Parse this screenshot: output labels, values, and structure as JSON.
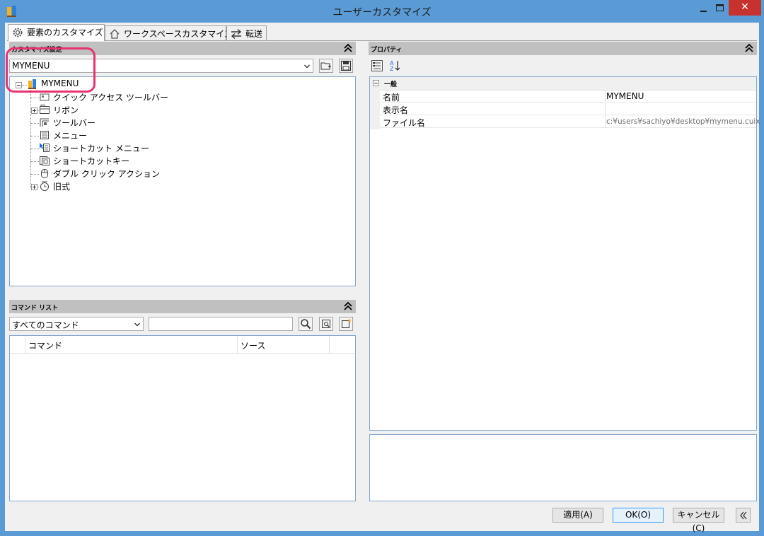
{
  "window": {
    "title": "ユーザーカスタマイズ"
  },
  "tabs": [
    {
      "label": "要素のカスタマイズ"
    },
    {
      "label": "ワークスペースカスタマイズ"
    },
    {
      "label": "転送"
    }
  ],
  "customize_panel": {
    "header": "カスタマイズ設定",
    "selected_file": "MYMENU",
    "tree": {
      "root": "MYMENU",
      "children": [
        {
          "label": "クイック アクセス ツールバー"
        },
        {
          "label": "リボン"
        },
        {
          "label": "ツールバー"
        },
        {
          "label": "メニュー"
        },
        {
          "label": "ショートカット メニュー"
        },
        {
          "label": "ショートカットキー"
        },
        {
          "label": "ダブル クリック アクション"
        },
        {
          "label": "旧式"
        }
      ]
    }
  },
  "command_panel": {
    "header": "コマンド リスト",
    "filter": "すべてのコマンド",
    "search_value": "",
    "columns": [
      "コマンド",
      "ソース"
    ]
  },
  "properties_panel": {
    "header": "プロパティ",
    "category": "一般",
    "rows": [
      {
        "name": "名前",
        "value": "MYMENU"
      },
      {
        "name": "表示名",
        "value": ""
      },
      {
        "name": "ファイル名",
        "value": "c:¥users¥sachiyo¥desktop¥mymenu.cuix"
      }
    ]
  },
  "buttons": {
    "apply": "適用(A)",
    "ok": "OK(O)",
    "cancel": "キャンセル(C)"
  },
  "colors": {
    "highlight": "#e8336e",
    "window_frame": "#5b9bd5",
    "close": "#c7322f"
  }
}
